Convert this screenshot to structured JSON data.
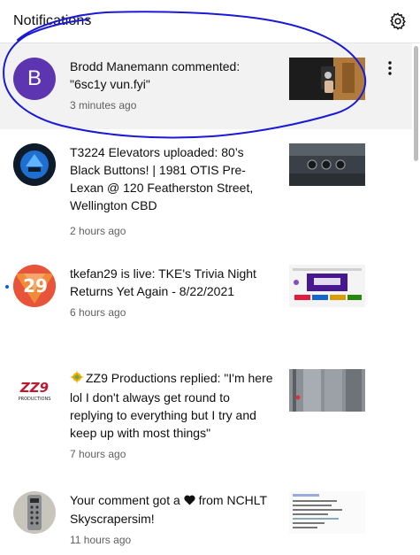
{
  "header": {
    "title": "Notifications"
  },
  "icons": {
    "settings": "gear-icon",
    "more": "more-vert-icon",
    "heart": "heart-icon",
    "sparkle": "sparkle-icon"
  },
  "colors": {
    "unread_dot": "#065fd4",
    "annotation": "#1a1ad6",
    "avatar_b": "#5e35b1"
  },
  "notifications": [
    {
      "avatar_letter": "B",
      "message": "Brodd Manemann commented: \"6sc1y vun.fyi\"",
      "time": "3 minutes ago",
      "highlighted": true,
      "unread": false
    },
    {
      "message": "T3224 Elevators uploaded: 80’s Black Buttons! | 1981 OTIS Pre-Lexan @ 120 Featherston Street, Wellington CBD",
      "time": "2 hours ago",
      "unread": false
    },
    {
      "avatar_text": "29",
      "message": "tkefan29 is live: TKE's Trivia Night Returns Yet Again - 8/22/2021",
      "time": "6 hours ago",
      "unread": true
    },
    {
      "avatar_text": "ZZ9",
      "avatar_subtext": "PRODUCTIONS",
      "message": "ZZ9 Productions replied: \"I'm here lol I don't always get round to replying to everything but I try and keep up with most things\"",
      "time": "7 hours ago",
      "unread": false
    },
    {
      "message_prefix": "Your comment got a",
      "message_suffix": "from NCHLT Skyscrapersim!",
      "time": "11 hours ago",
      "unread": false
    }
  ]
}
